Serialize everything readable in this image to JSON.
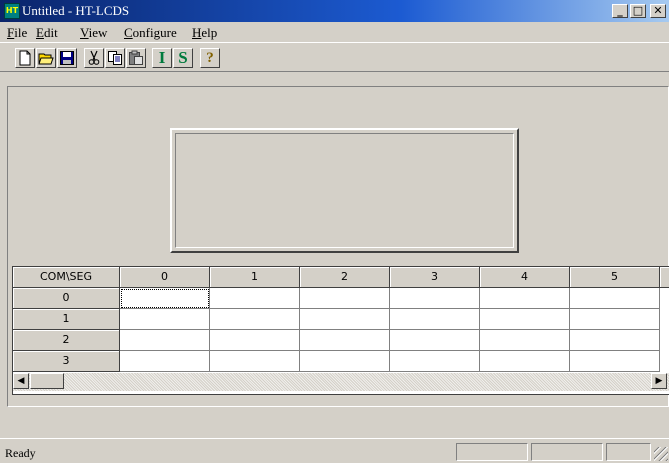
{
  "window": {
    "title": "Untitled - HT-LCDS",
    "icon": "ht-lcds-app-icon",
    "icon_text": "HT",
    "controls": {
      "minimize": "_",
      "maximize": "□",
      "close": "✕"
    }
  },
  "menubar": {
    "items": [
      {
        "label": "File"
      },
      {
        "label": "Edit"
      },
      {
        "label": "View"
      },
      {
        "label": "Configure"
      },
      {
        "label": "Help"
      }
    ]
  },
  "toolbar": {
    "buttons": [
      {
        "name": "new-file",
        "icon": "new-document-icon"
      },
      {
        "name": "open-file",
        "icon": "open-folder-icon"
      },
      {
        "name": "save-file",
        "icon": "floppy-disk-icon"
      },
      {
        "name": "cut",
        "icon": "scissors-icon"
      },
      {
        "name": "copy",
        "icon": "copy-icon"
      },
      {
        "name": "paste",
        "icon": "paste-icon"
      },
      {
        "name": "i-tool",
        "label": "I"
      },
      {
        "name": "s-tool",
        "label": "S"
      },
      {
        "name": "help",
        "icon": "help-question-icon",
        "label": "?"
      }
    ]
  },
  "grid": {
    "corner_header": "COM\\SEG",
    "columns": [
      "0",
      "1",
      "2",
      "3",
      "4",
      "5"
    ],
    "rows": [
      "0",
      "1",
      "2",
      "3"
    ],
    "active_cell": {
      "row": "0",
      "column": "0"
    },
    "scroll": {
      "left_arrow": "◀",
      "right_arrow": "▶"
    }
  },
  "statusbar": {
    "text": "Ready"
  }
}
